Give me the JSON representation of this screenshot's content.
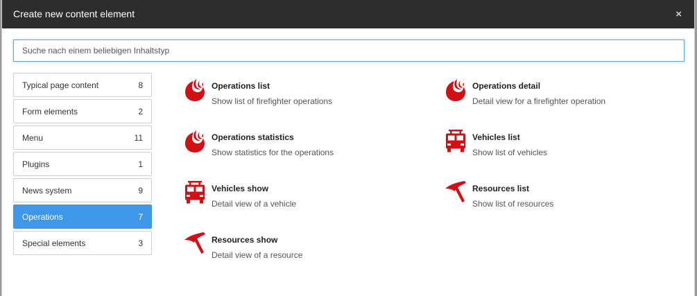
{
  "dialog": {
    "title": "Create new content element",
    "close_glyph": "×"
  },
  "search": {
    "placeholder": "Suche nach einem beliebigen Inhaltstyp",
    "value": ""
  },
  "categories": [
    {
      "label": "Typical page content",
      "count": "8"
    },
    {
      "label": "Form elements",
      "count": "2"
    },
    {
      "label": "Menu",
      "count": "11"
    },
    {
      "label": "Plugins",
      "count": "1"
    },
    {
      "label": "News system",
      "count": "9"
    },
    {
      "label": "Operations",
      "count": "7",
      "active": true
    },
    {
      "label": "Special elements",
      "count": "3"
    }
  ],
  "elements": [
    {
      "title": "Operations list",
      "description": "Show list of firefighter operations",
      "icon": "flame-icon"
    },
    {
      "title": "Operations detail",
      "description": "Detail view for a firefighter operation",
      "icon": "flame-icon"
    },
    {
      "title": "Operations statistics",
      "description": "Show statistics for the operations",
      "icon": "flame-icon"
    },
    {
      "title": "Vehicles list",
      "description": "Show list of vehicles",
      "icon": "fire-truck-icon"
    },
    {
      "title": "Vehicles show",
      "description": "Detail view of a vehicle",
      "icon": "fire-truck-icon"
    },
    {
      "title": "Resources list",
      "description": "Show list of resources",
      "icon": "axe-icon"
    },
    {
      "title": "Resources show",
      "description": "Detail view of a resource",
      "icon": "axe-icon"
    }
  ],
  "colors": {
    "accent": "#3f97e9",
    "icon_red": "#d40f14",
    "header_bg": "#2d2d2d"
  }
}
